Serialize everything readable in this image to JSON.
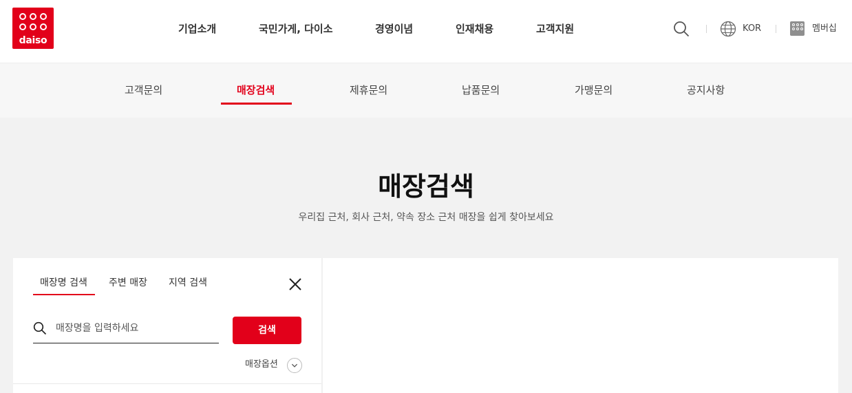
{
  "brand": {
    "logo_text": "daiso",
    "accent": "#e2001a"
  },
  "gnb": [
    {
      "label": "기업소개"
    },
    {
      "label": "국민가게, 다이소"
    },
    {
      "label": "경영이념"
    },
    {
      "label": "인재채용"
    },
    {
      "label": "고객지원"
    }
  ],
  "util": {
    "search_icon": "search-icon",
    "language": "KOR",
    "membership": "멤버십"
  },
  "subnav": [
    {
      "label": "고객문의"
    },
    {
      "label": "매장검색",
      "active": true
    },
    {
      "label": "제휴문의"
    },
    {
      "label": "납품문의"
    },
    {
      "label": "가맹문의"
    },
    {
      "label": "공지사항"
    }
  ],
  "page": {
    "title": "매장검색",
    "description": "우리집 근처, 회사 근처, 약속 장소 근처 매장을 쉽게 찾아보세요"
  },
  "panel": {
    "tabs": [
      {
        "label": "매장명 검색",
        "active": true
      },
      {
        "label": "주변 매장"
      },
      {
        "label": "지역 검색"
      }
    ],
    "search": {
      "placeholder": "매장명을 입력하세요",
      "value": ""
    },
    "search_button": "검색",
    "option_label": "매장옵션"
  }
}
